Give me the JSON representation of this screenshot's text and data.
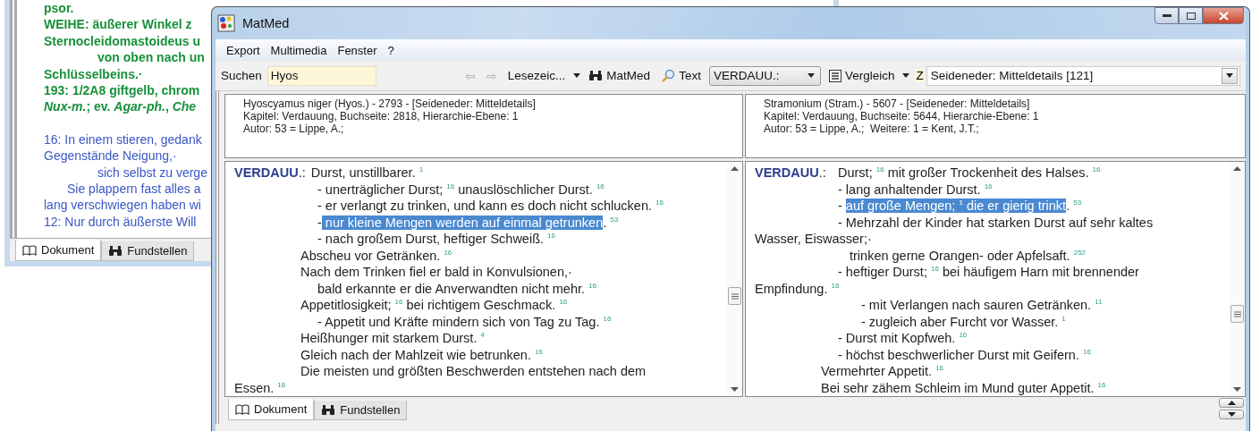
{
  "background_window": {
    "lines": [
      {
        "kind": "remedy",
        "text": "psor."
      },
      {
        "kind": "remedy",
        "text": "WEIHE: äußerer Winkel z"
      },
      {
        "kind": "remedy",
        "text": "Sternocleidomastoideus u"
      },
      {
        "kind": "remedyindented",
        "text": "von oben nach un"
      },
      {
        "kind": "remedy",
        "text": "Schlüsselbeins.·"
      },
      {
        "kind": "remedy",
        "text": "193: 1/2A8 giftgelb, chrom"
      },
      {
        "kind": "remedy",
        "text": "*Nux-m.*; ev. *Agar-ph.*, *Che*"
      },
      {
        "kind": "notespaced",
        "text": "16: In einem stieren, gedank"
      },
      {
        "kind": "note",
        "text": "Gegenstände Neigung,·"
      },
      {
        "kind": "noteindented",
        "text": "sich selbst zu verge"
      },
      {
        "kind": "notehalf",
        "text": "Sie plappern fast alles a"
      },
      {
        "kind": "note",
        "text": "lang verschwiegen haben wi"
      },
      {
        "kind": "note",
        "text": "12: Nur durch äußerste Will"
      }
    ],
    "tabs": [
      {
        "label": "Dokument",
        "selected": true
      },
      {
        "label": "Fundstellen",
        "selected": false
      }
    ]
  },
  "window": {
    "title": "MatMed"
  },
  "menu": [
    "Export",
    "Multimedia",
    "Fenster",
    "?"
  ],
  "toolbar": {
    "search_label": "Suchen",
    "search_value": "Hyos",
    "back": {
      "label": "⇦",
      "disabled": true
    },
    "forward": {
      "label": "⇨",
      "disabled": true
    },
    "bookmarks": "Lesezeic...",
    "matmed": "MatMed",
    "text": "Text",
    "chapter": "VERDAUU.:",
    "compare": "Vergleich",
    "z": "Z",
    "source": "Seideneder: Mitteldetails [121]"
  },
  "panes": [
    {
      "header": [
        "Hyoscyamus niger (Hyos.) - 2793 - [Seideneder: Mitteldetails]",
        "Kapitel: Verdauung, Buchseite: 2818, Hierarchie-Ebene: 1",
        "Autor: 53 = Lippe, A.;"
      ],
      "lines": [
        {
          "kind": "head",
          "label": "**VERDAUU**.:",
          "text": "Durst, unstillbarer. $^{1}$"
        },
        {
          "kind": "sub",
          "text": "- unerträglicher Durst; $^{16}$ unauslöschlicher Durst. $^{16}$"
        },
        {
          "kind": "sub",
          "text": "- er verlangt zu trinken, und kann es doch nicht schlucken. $^{16}$"
        },
        {
          "kind": "sub",
          "segments": [
            {
              "text": "-",
              "selected": false
            },
            {
              "text": " nur kleine Mengen werden auf einmal getrunken",
              "selected": true
            },
            {
              "text": ". $^{53}$",
              "selected": false
            }
          ]
        },
        {
          "kind": "sub",
          "text": "- nach großem Durst, heftiger Schweiß. $^{16}$"
        },
        {
          "kind": "item",
          "text": "Abscheu vor Getränken. $^{16}$"
        },
        {
          "kind": "item",
          "text": "Nach dem Trinken fiel er bald in Konvulsionen,·"
        },
        {
          "kind": "sub",
          "text": "bald erkannte er die Anverwandten nicht mehr. $^{16}$"
        },
        {
          "kind": "item",
          "text": "Appetitlosigkeit; $^{16}$ bei richtigem Geschmack. $^{16}$"
        },
        {
          "kind": "sub",
          "text": "- Appetit und Kräfte mindern sich von Tag zu Tag. $^{16}$"
        },
        {
          "kind": "item",
          "text": "Heißhunger mit starkem Durst. $^{4}$"
        },
        {
          "kind": "item",
          "text": "Gleich nach der Mahlzeit wie betrunken. $^{16}$"
        },
        {
          "kind": "item",
          "text": "Die meisten und größten Beschwerden entstehen nach dem"
        },
        {
          "kind": "flush",
          "text": "Essen. $^{16}$"
        }
      ]
    },
    {
      "header": [
        "Stramonium (Stram.) - 5607 - [Seideneder: Mitteldetails]",
        "Kapitel: Verdauung, Buchseite: 5644, Hierarchie-Ebene: 1",
        "Autor: 53 = Lippe, A.;  Weitere: 1 = Kent, J.T.;"
      ],
      "lines": [
        {
          "kind": "head",
          "label": "**VERDAUU**.:",
          "text": "Durst; $^{16}$ mit großer Trockenheit des Halses. $^{16}$"
        },
        {
          "kind": "sub",
          "text": "- lang anhaltender Durst. $^{16}$"
        },
        {
          "kind": "sub",
          "segments": [
            {
              "text": "- ",
              "selected": false
            },
            {
              "text": "auf große Mengen; $^{1}$ die er gierig trinkt",
              "selected": true
            },
            {
              "text": ". $^{53}$",
              "selected": false
            }
          ]
        },
        {
          "kind": "sub",
          "text": "- Mehrzahl der Kinder hat starken Durst auf sehr kaltes"
        },
        {
          "kind": "flush",
          "text": "Wasser, Eiswasser;·"
        },
        {
          "kind": "cont",
          "text": "trinken gerne Orangen- oder Apfelsaft. $^{252}$"
        },
        {
          "kind": "sub",
          "text": "- heftiger Durst; $^{16}$ bei häufigem Harn mit brennender"
        },
        {
          "kind": "flush",
          "text": "Empfindung. $^{16}$"
        },
        {
          "kind": "deep",
          "text": "- mit Verlangen nach sauren Getränken. $^{11}$"
        },
        {
          "kind": "deep",
          "text": "- zugleich aber Furcht vor Wasser. $^{1}$"
        },
        {
          "kind": "sub",
          "text": "- Durst mit Kopfweh. $^{16}$"
        },
        {
          "kind": "sub",
          "text": "- höchst beschwerlicher Durst mit Geifern. $^{16}$"
        },
        {
          "kind": "item",
          "text": "Vermehrter Appetit. $^{16}$"
        },
        {
          "kind": "item",
          "text": "Bei sehr zähem Schleim im Mund guter Appetit. $^{16}$"
        }
      ]
    }
  ],
  "bottom_tabs": [
    {
      "label": "Dokument",
      "selected": true
    },
    {
      "label": "Fundstellen",
      "selected": false
    }
  ]
}
